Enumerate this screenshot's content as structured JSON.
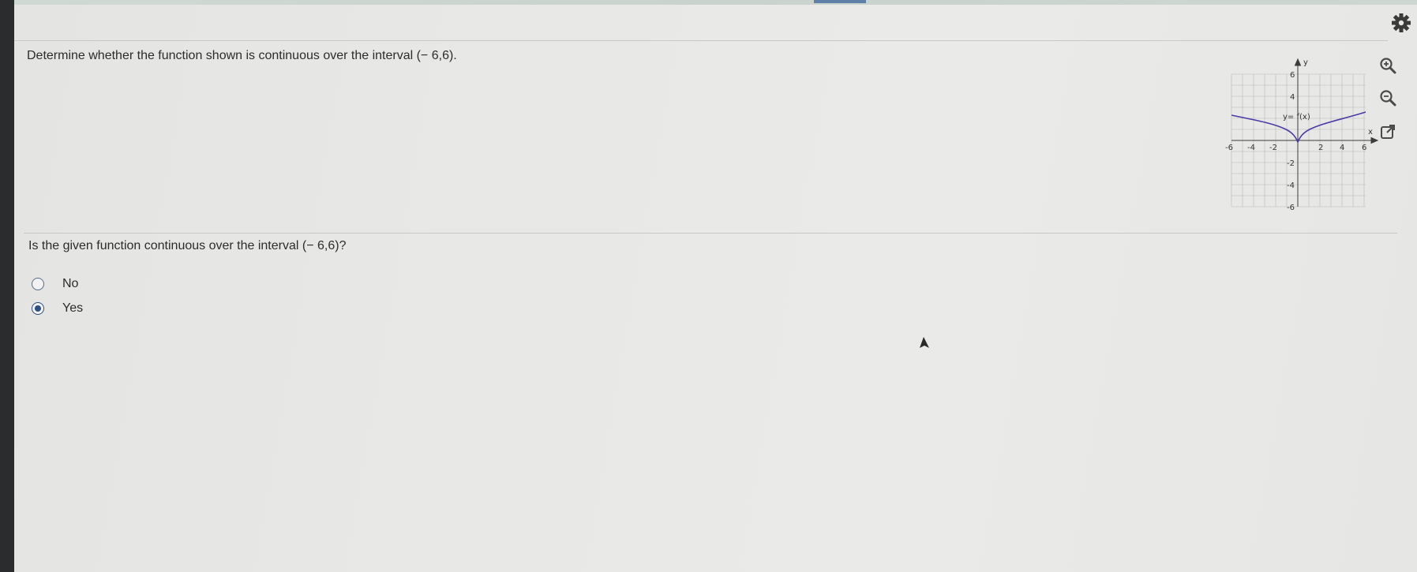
{
  "question": {
    "prompt": "Determine whether the function shown is continuous over the interval (− 6,6).",
    "sub_question": "Is the given function continuous over the interval (− 6,6)?"
  },
  "options": [
    {
      "label": "No",
      "selected": false
    },
    {
      "label": "Yes",
      "selected": true
    }
  ],
  "graph": {
    "axis_x_label": "x",
    "axis_y_label": "y",
    "curve_label": "y= f(x)",
    "x_ticks": [
      "-6",
      "-4",
      "-2",
      "2",
      "4",
      "6"
    ],
    "y_ticks": [
      "6",
      "4",
      "-2",
      "-4",
      "-6"
    ]
  },
  "toolbar": {
    "icons": [
      "zoom-in-icon",
      "zoom-out-icon",
      "open-window-icon",
      "gear-icon"
    ]
  },
  "colors": {
    "curve": "#4b3aa6",
    "radio_selected": "#2c4f86"
  }
}
